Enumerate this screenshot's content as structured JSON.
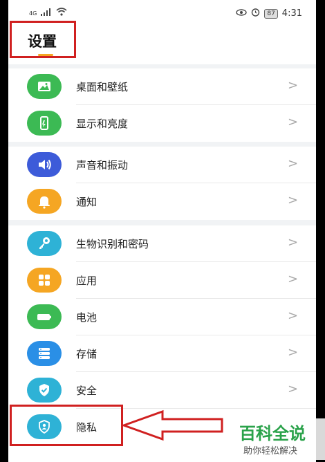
{
  "status_bar": {
    "network": "4G",
    "battery": "87",
    "time": "4:31"
  },
  "header": {
    "title": "设置"
  },
  "groups": [
    {
      "items": [
        {
          "label": "桌面和壁纸",
          "icon": "image-icon",
          "color": "#3cba54"
        },
        {
          "label": "显示和亮度",
          "icon": "display-icon",
          "color": "#3cba54"
        }
      ]
    },
    {
      "items": [
        {
          "label": "声音和振动",
          "icon": "speaker-icon",
          "color": "#3d5bd9"
        },
        {
          "label": "通知",
          "icon": "bell-icon",
          "color": "#f5a623"
        }
      ]
    },
    {
      "items": [
        {
          "label": "生物识别和密码",
          "icon": "key-icon",
          "color": "#2eb2d6"
        },
        {
          "label": "应用",
          "icon": "apps-icon",
          "color": "#f5a623"
        },
        {
          "label": "电池",
          "icon": "battery-icon",
          "color": "#3cba54"
        },
        {
          "label": "存储",
          "icon": "storage-icon",
          "color": "#2a8fe6"
        },
        {
          "label": "安全",
          "icon": "shield-check-icon",
          "color": "#2eb2d6"
        },
        {
          "label": "隐私",
          "icon": "privacy-icon",
          "color": "#2eb2d6"
        }
      ]
    }
  ],
  "chevron": ">",
  "watermark": {
    "main": "百科全说",
    "sub": "助你轻松解决"
  },
  "colors": {
    "highlight": "#d02020",
    "accent": "#f5a623"
  }
}
